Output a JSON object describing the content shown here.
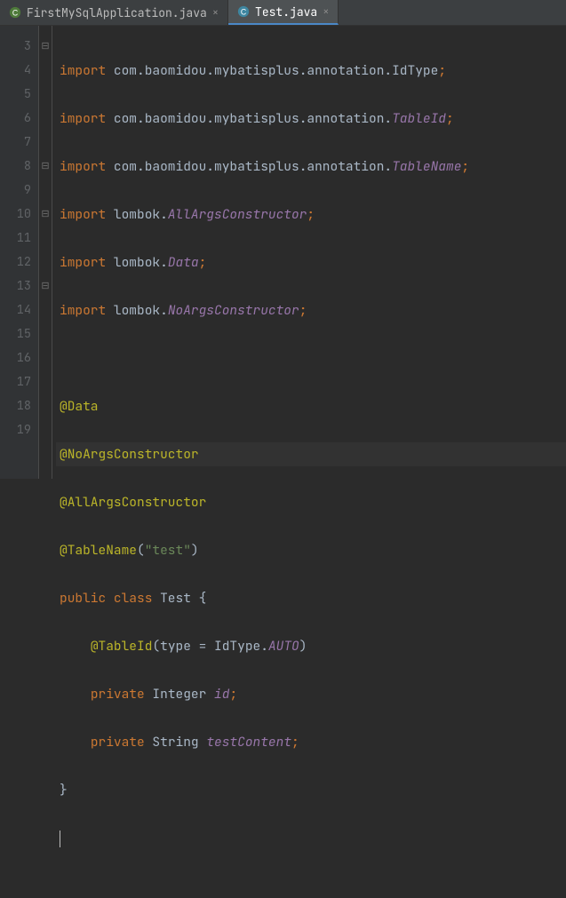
{
  "tabs": [
    {
      "label": "FirstMySqlApplication.java",
      "active": false
    },
    {
      "label": "Test.java",
      "active": true
    }
  ],
  "gutter": {
    "start": 3,
    "end": 19
  },
  "fold_markers": [
    {
      "line": 3,
      "glyph": "⊟"
    },
    {
      "line": 8,
      "glyph": "⊟"
    },
    {
      "line": 10,
      "glyph": "⊟"
    },
    {
      "line": 13,
      "glyph": "⊟"
    }
  ],
  "code": {
    "kw_import": "import",
    "kw_public": "public",
    "kw_class": "class",
    "kw_private": "private",
    "pkg_base": "com.baomidou.mybatisplus.annotation.",
    "cls_IdType": "IdType",
    "cls_TableId": "TableId",
    "cls_TableName": "TableName",
    "pkg_lombok": "lombok.",
    "cls_AllArgs": "AllArgsConstructor",
    "cls_Data": "Data",
    "cls_NoArgs": "NoArgsConstructor",
    "ann_Data": "@Data",
    "ann_NoArgs": "@NoArgsConstructor",
    "ann_AllArgs": "@AllArgsConstructor",
    "ann_TableName": "@TableName",
    "str_test": "\"test\"",
    "cls_Test": "Test",
    "ann_TableId": "@TableId",
    "arg_type": "type = IdType.",
    "enum_AUTO": "AUTO",
    "type_Integer": "Integer",
    "fld_id": "id",
    "type_String": "String",
    "fld_testContent": "testContent",
    "semi": ";",
    "lbrace": "{",
    "rbrace": "}",
    "lp": "(",
    "rp": ")"
  },
  "colors": {
    "keyword": "#cc7832",
    "annotation": "#bbb529",
    "string": "#6a8759",
    "field": "#9876aa",
    "text": "#a9b7c6",
    "bg": "#2b2b2b",
    "gutter_bg": "#313335"
  }
}
